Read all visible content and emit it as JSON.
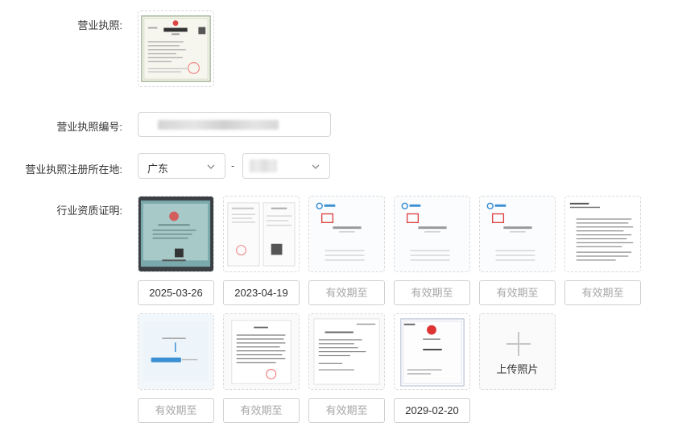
{
  "form": {
    "license_label": "营业执照:",
    "license_no_label": "营业执照编号:",
    "location_label": "营业执照注册所在地:",
    "qualification_label": "行业资质证明:"
  },
  "location": {
    "province": "广东",
    "separator": "-"
  },
  "qualification": {
    "dates": [
      "2025-03-26",
      "2023-04-19",
      "有效期至",
      "有效期至",
      "有效期至",
      "有效期至",
      "有效期至",
      "有效期至",
      "有效期至",
      "2029-02-20"
    ],
    "upload_label": "上传照片"
  },
  "colors": {
    "border": "#d6d6d6",
    "placeholder": "#a7a7a7",
    "text": "#333333"
  }
}
